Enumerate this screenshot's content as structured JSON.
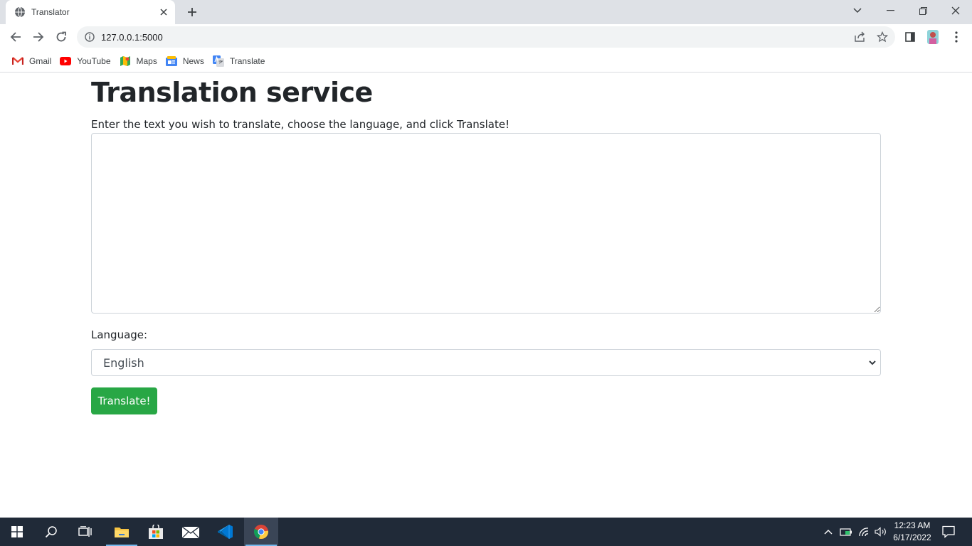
{
  "browser": {
    "tab_title": "Translator",
    "url": "127.0.0.1:5000",
    "bookmarks": [
      {
        "label": "Gmail",
        "icon": "gmail-icon"
      },
      {
        "label": "YouTube",
        "icon": "youtube-icon"
      },
      {
        "label": "Maps",
        "icon": "maps-icon"
      },
      {
        "label": "News",
        "icon": "news-icon"
      },
      {
        "label": "Translate",
        "icon": "translate-icon"
      }
    ]
  },
  "page": {
    "title": "Translation service",
    "intro": "Enter the text you wish to translate, choose the language, and click Translate!",
    "textarea_value": "",
    "language_label": "Language:",
    "language_selected": "English",
    "button_label": "Translate!",
    "button_color": "#28a745"
  },
  "taskbar": {
    "time": "12:23 AM",
    "date": "6/17/2022",
    "pinned": [
      "start-icon",
      "search-icon",
      "task-view-icon",
      "file-explorer-icon",
      "store-icon",
      "mail-icon",
      "vscode-icon",
      "chrome-icon"
    ]
  }
}
